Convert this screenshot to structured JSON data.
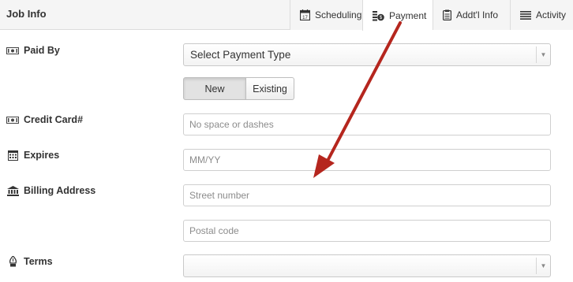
{
  "header": {
    "title": "Job Info"
  },
  "tabs": [
    {
      "label": "Scheduling",
      "icon": "calendar-icon"
    },
    {
      "label": "Payment",
      "icon": "coins-icon"
    },
    {
      "label": "Addt'l Info",
      "icon": "clipboard-icon"
    },
    {
      "label": "Activity",
      "icon": "list-icon"
    }
  ],
  "form": {
    "paid_by": {
      "label": "Paid By",
      "icon": "money-icon",
      "value": "Select Payment Type"
    },
    "toggle": {
      "new": "New",
      "existing": "Existing",
      "selected": "New"
    },
    "credit_card": {
      "label": "Credit Card#",
      "icon": "money-icon",
      "placeholder": "No space or dashes"
    },
    "expires": {
      "label": "Expires",
      "icon": "calendar-icon",
      "placeholder": "MM/YY"
    },
    "billing": {
      "label": "Billing Address",
      "icon": "bank-icon",
      "street_placeholder": "Street number",
      "postal_placeholder": "Postal code"
    },
    "terms": {
      "label": "Terms",
      "icon": "pen-nib-icon",
      "value": ""
    }
  },
  "colors": {
    "arrow": "#b5261e",
    "header_bg": "#f5f5f5",
    "active_tab_bg": "#ffffff"
  }
}
